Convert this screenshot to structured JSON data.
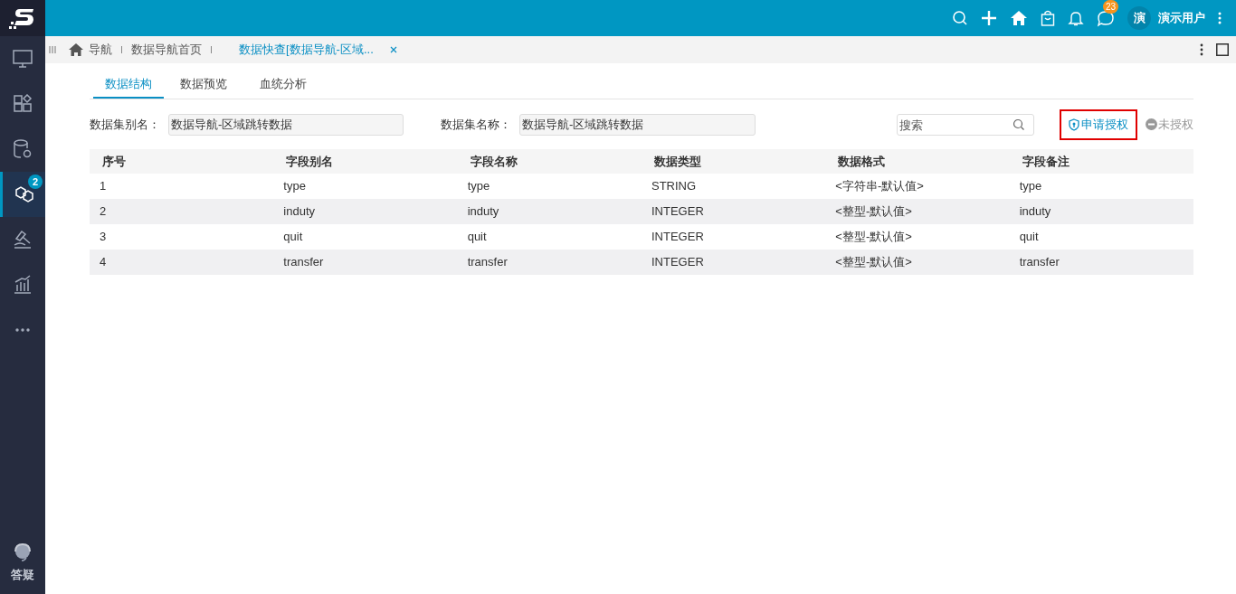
{
  "top_bar": {
    "message_badge": "23",
    "avatar": "演",
    "user_name": "演示用户"
  },
  "sidebar": {
    "items": [
      {
        "kind": "monitor",
        "selected": false
      },
      {
        "kind": "widgets",
        "selected": false
      },
      {
        "kind": "database",
        "selected": false
      },
      {
        "kind": "cubes",
        "selected": true,
        "badge": "2"
      },
      {
        "kind": "hammer",
        "selected": false
      },
      {
        "kind": "chart",
        "selected": false
      },
      {
        "kind": "more",
        "selected": false
      }
    ],
    "help_label": "答疑"
  },
  "page_tabs": [
    {
      "label": "导航",
      "selected": false,
      "home": true,
      "closable": false
    },
    {
      "label": "数据导航首页",
      "selected": false,
      "home": false,
      "closable": false
    },
    {
      "label": "数据快查[数据导航-区域...",
      "selected": true,
      "home": false,
      "closable": true
    }
  ],
  "sub_tabs": [
    {
      "label": "数据结构",
      "selected": true
    },
    {
      "label": "数据预览",
      "selected": false
    },
    {
      "label": "血统分析",
      "selected": false
    }
  ],
  "form": {
    "alias_label": "数据集别名：",
    "alias_value": "数据导航-区域跳转数据",
    "name_label": "数据集名称：",
    "name_value": "数据导航-区域跳转数据",
    "search_placeholder": "搜索",
    "apply_button": "申请授权",
    "status": "未授权"
  },
  "table": {
    "columns": [
      "序号",
      "字段别名",
      "字段名称",
      "数据类型",
      "数据格式",
      "字段备注"
    ],
    "rows": [
      [
        "1",
        "type",
        "type",
        "STRING",
        "<字符串-默认值>",
        "type"
      ],
      [
        "2",
        "induty",
        "induty",
        "INTEGER",
        "<整型-默认值>",
        "induty"
      ],
      [
        "3",
        "quit",
        "quit",
        "INTEGER",
        "<整型-默认值>",
        "quit"
      ],
      [
        "4",
        "transfer",
        "transfer",
        "INTEGER",
        "<整型-默认值>",
        "transfer"
      ]
    ]
  }
}
